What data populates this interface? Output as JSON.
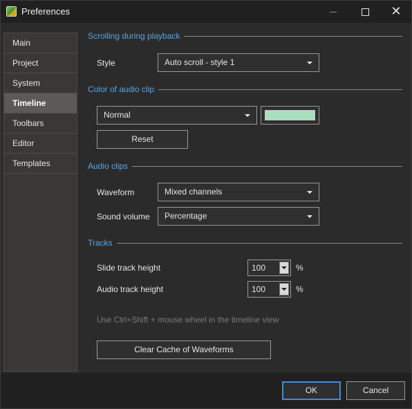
{
  "window": {
    "title": "Preferences",
    "minimize_icon": "minimize-icon",
    "maximize_icon": "maximize-icon",
    "close_glyph": "✕"
  },
  "sidebar": {
    "items": [
      {
        "label": "Main"
      },
      {
        "label": "Project"
      },
      {
        "label": "System"
      },
      {
        "label": "Timeline",
        "active": true
      },
      {
        "label": "Toolbars"
      },
      {
        "label": "Editor"
      },
      {
        "label": "Templates"
      }
    ]
  },
  "scrolling": {
    "title": "Scrolling during playback",
    "style_label": "Style",
    "style_value": "Auto scroll - style 1"
  },
  "audio_color": {
    "title": "Color of audio clip",
    "mode_value": "Normal",
    "swatch_color": "#a8dfbf",
    "reset_label": "Reset"
  },
  "audio_clips": {
    "title": "Audio clips",
    "waveform_label": "Waveform",
    "waveform_value": "Mixed channels",
    "sound_volume_label": "Sound volume",
    "sound_volume_value": "Percentage"
  },
  "tracks": {
    "title": "Tracks",
    "slide_height_label": "Slide track height",
    "slide_height_value": "100",
    "slide_height_unit": "%",
    "audio_height_label": "Audio track height",
    "audio_height_value": "100",
    "audio_height_unit": "%",
    "hint": "Use Ctrl+Shift + mouse wheel in the timeline view",
    "clear_cache_label": "Clear Cache of Waveforms"
  },
  "footer": {
    "ok_label": "OK",
    "cancel_label": "Cancel"
  },
  "colors": {
    "accent": "#58a6e6",
    "primary_button_border": "#3d8ee0",
    "active_nav_bg": "#5c5a56"
  }
}
